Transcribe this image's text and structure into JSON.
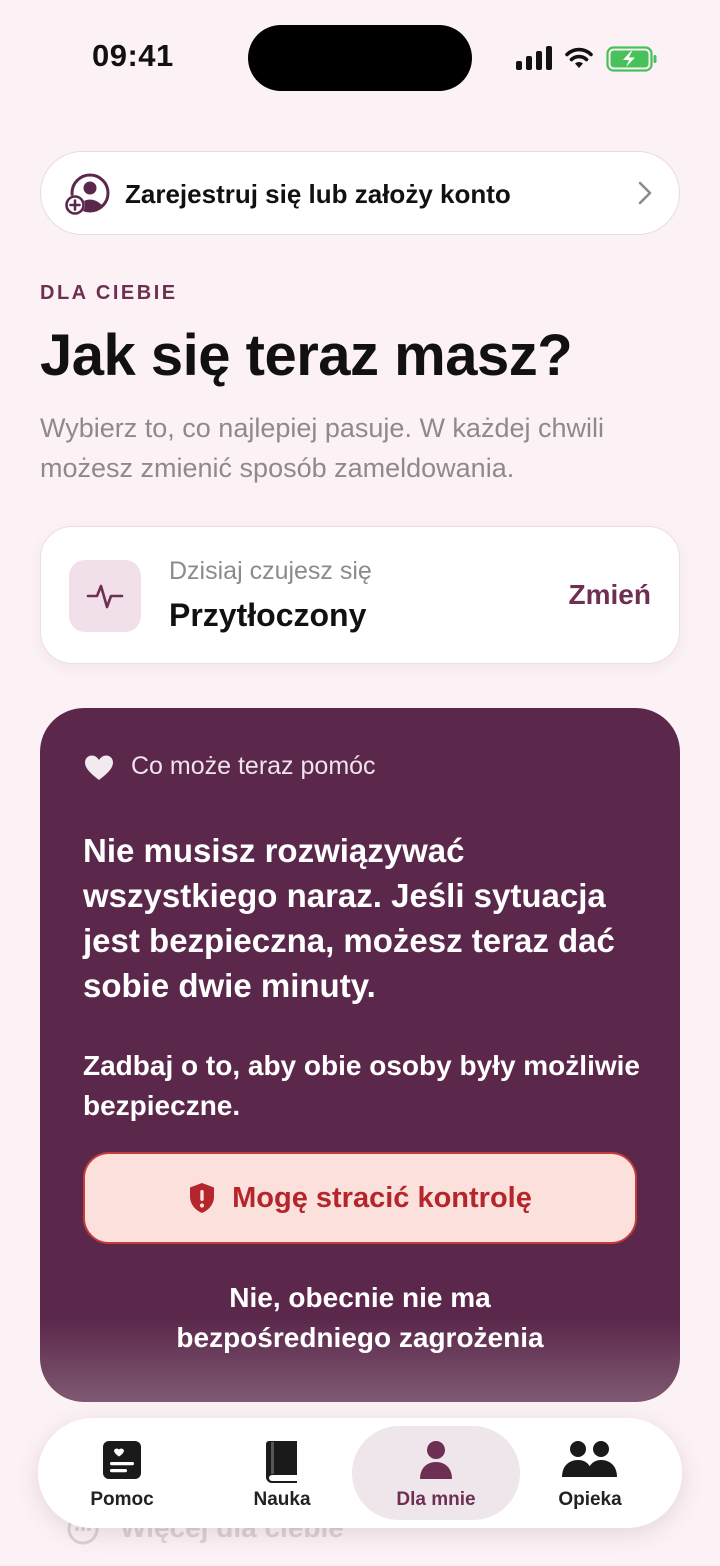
{
  "status": {
    "time": "09:41"
  },
  "register": {
    "label": "Zarejestruj się lub założy konto"
  },
  "section": {
    "eyebrow": "DLA CIEBIE",
    "title": "Jak się teraz masz?",
    "subtitle": "Wybierz to, co najlepiej pasuje. W każdej chwili możesz zmienić sposób zameldowania."
  },
  "mood": {
    "label": "Dzisiaj czujesz się",
    "value": "Przytłoczony",
    "change": "Zmień"
  },
  "help": {
    "heading": "Co może teraz pomóc",
    "message": "Nie musisz rozwiązywać wszystkiego naraz. Jeśli sytuacja jest bezpieczna, możesz teraz dać sobie dwie minuty.",
    "note": "Zadbaj o to, aby obie osoby były możliwie bezpieczne.",
    "lose_control": "Mogę stracić kontrolę",
    "no_danger_line1": "Nie, obecnie nie ma",
    "no_danger_line2": "bezpośredniego zagrożenia"
  },
  "more": {
    "label": "Więcej dla ciebie"
  },
  "tabs": [
    {
      "label": "Pomoc",
      "icon": "help-card-icon"
    },
    {
      "label": "Nauka",
      "icon": "book-icon"
    },
    {
      "label": "Dla mnie",
      "icon": "person-icon",
      "active": true
    },
    {
      "label": "Opieka",
      "icon": "people-icon"
    }
  ],
  "colors": {
    "accent": "#6d2f52",
    "card": "#5b284c",
    "danger": "#c23b3d",
    "background": "#fcf2f6"
  }
}
